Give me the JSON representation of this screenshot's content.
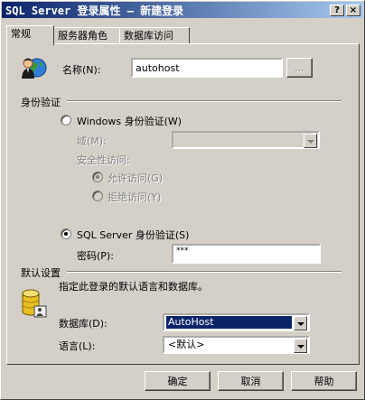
{
  "window": {
    "title": "SQL Server 登录属性 — 新建登录"
  },
  "tabs": [
    {
      "label": "常规"
    },
    {
      "label": "服务器角色"
    },
    {
      "label": "数据库访问"
    }
  ],
  "general": {
    "name_label": "名称(N):",
    "name_value": "autohost",
    "browse_label": "...",
    "auth_group_label": "身份验证",
    "windows_auth_label": "Windows 身份验证(W)",
    "domain_label": "域(M):",
    "domain_value": "",
    "security_access_label": "安全性访问:",
    "allow_access_label": "允许访问(G)",
    "deny_access_label": "拒绝访问(Y)",
    "sql_auth_label": "SQL Server 身份验证(S)",
    "password_label": "密码(P):",
    "password_value": "***",
    "defaults_group_label": "默认设置",
    "defaults_desc": "指定此登录的默认语言和数据库。",
    "database_label": "数据库(D):",
    "database_value": "AutoHost",
    "language_label": "语言(L):",
    "language_value": "<默认>"
  },
  "buttons": {
    "ok": "确定",
    "cancel": "取消",
    "help": "帮助"
  },
  "titlebar_buttons": {
    "help": "?",
    "close": "×"
  },
  "selected_auth": "SQL Server 身份验证",
  "selected_access": "允许访问"
}
